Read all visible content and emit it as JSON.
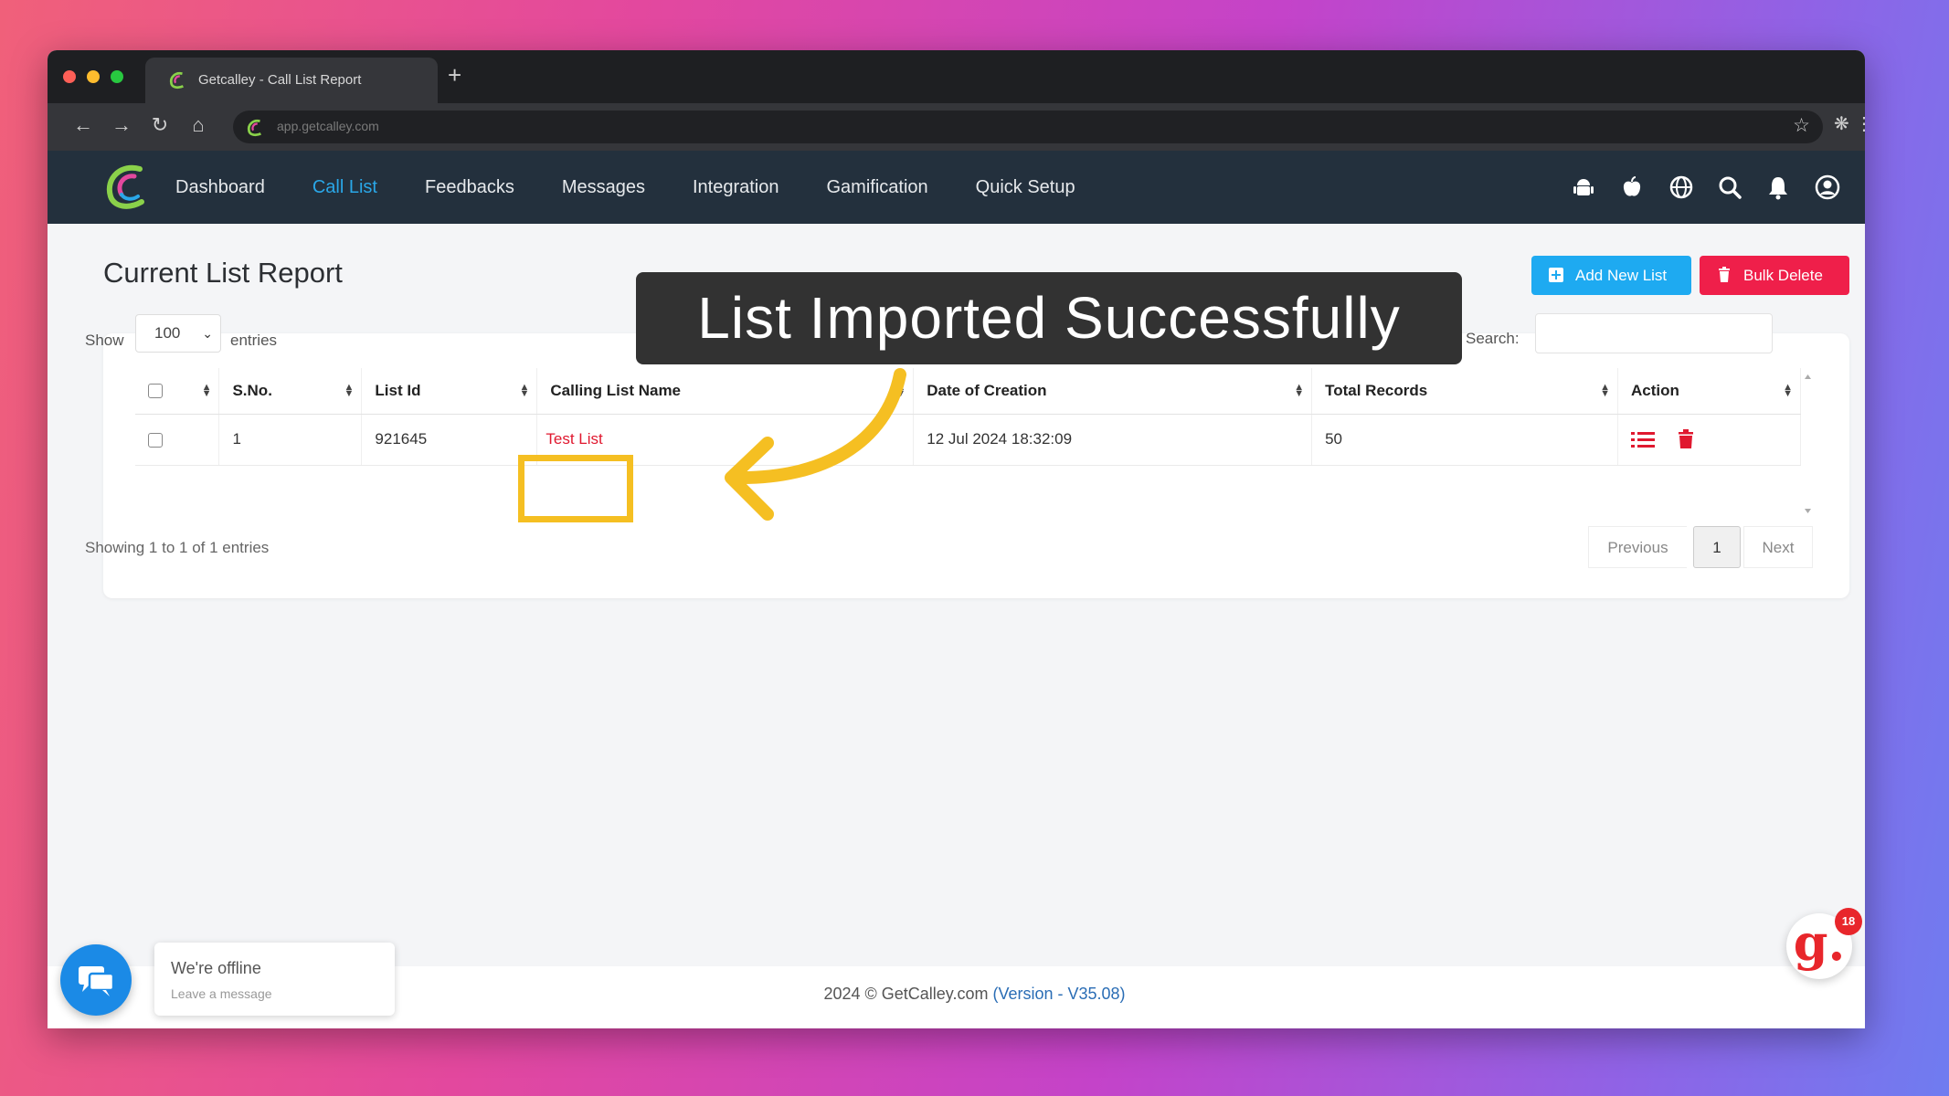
{
  "browser": {
    "tab_title": "Getcalley - Call List Report",
    "new_tab": "+",
    "url": "app.getcalley.com"
  },
  "nav": {
    "items": [
      "Dashboard",
      "Call List",
      "Feedbacks",
      "Messages",
      "Integration",
      "Gamification",
      "Quick Setup"
    ],
    "active_index": 1,
    "active_color": "#2aa7e8",
    "header_icons": [
      "android-icon",
      "apple-icon",
      "globe-icon",
      "search-icon",
      "bell-icon",
      "user-icon"
    ]
  },
  "page": {
    "title": "Current List Report",
    "add_button": "Add New List",
    "bulk_delete_button": "Bulk Delete"
  },
  "table_controls": {
    "show_label": "Show",
    "entries_value": "100",
    "entries_label": "entries",
    "search_label": "Search:"
  },
  "table": {
    "columns": [
      "",
      "S.No.",
      "List Id",
      "Calling List Name",
      "Date of Creation",
      "Total Records",
      "Action"
    ],
    "rows": [
      {
        "sno": "1",
        "list_id": "921645",
        "name": "Test List",
        "date": "12 Jul 2024 18:32:09",
        "total": "50"
      }
    ]
  },
  "pagination": {
    "info": "Showing 1 to 1 of 1 entries",
    "previous": "Previous",
    "page": "1",
    "next": "Next"
  },
  "overlay": {
    "banner": "List Imported Successfully",
    "highlight_color": "#f5bf22"
  },
  "footer": {
    "copyright": "2024 © GetCalley.com",
    "version": "(Version - V35.08)"
  },
  "chat": {
    "title": "We're offline",
    "subtitle": "Leave a message"
  },
  "gamify": {
    "label": "g.",
    "badge": "18"
  }
}
